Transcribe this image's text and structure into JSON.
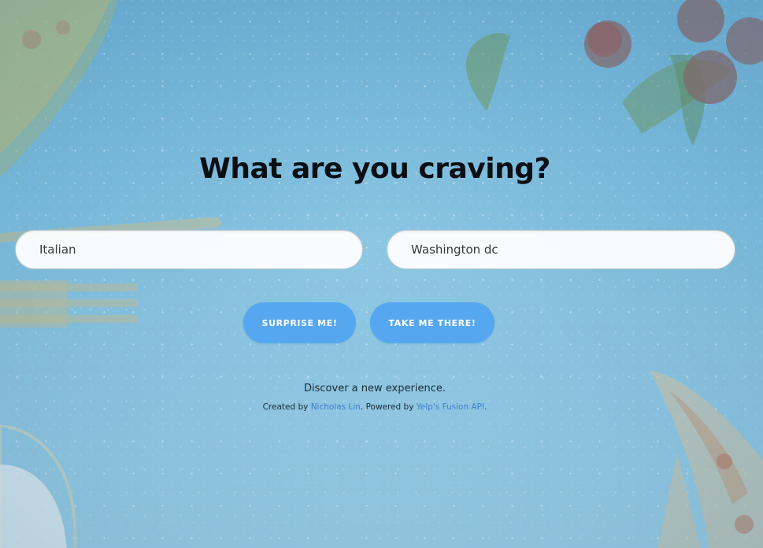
{
  "hero": {
    "title": "What are you craving?"
  },
  "search": {
    "food_value": "Italian",
    "location_value": "Washington dc"
  },
  "buttons": {
    "surprise_label": "SURPRISE ME!",
    "take_label": "TAKE ME THERE!"
  },
  "footer": {
    "tagline": "Discover a new experience.",
    "created_by_prefix": "Created by ",
    "author_link": "Nicholas Lin",
    "powered_by_text": ". Powered by ",
    "api_link": "Yelp's Fusion API",
    "suffix": "."
  },
  "colors": {
    "button_bg": "#55a7f0",
    "link": "#3f7fcf",
    "background": "#7fc0e0"
  },
  "icons": {
    "decorations": [
      "pizza-slice",
      "tomatoes",
      "parsley",
      "wooden-fork",
      "flour-bowl"
    ]
  }
}
